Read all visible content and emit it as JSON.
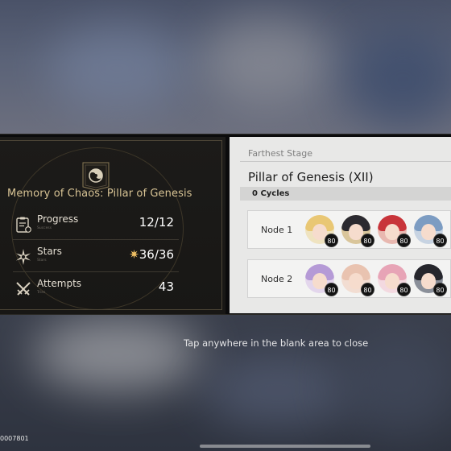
{
  "summary": {
    "title": "Memory of Chaos: Pillar of Genesis",
    "rows": [
      {
        "label": "Progress",
        "sub": "Success",
        "value": "12/12",
        "icon": "clipboard-icon"
      },
      {
        "label": "Stars",
        "sub": "Stars",
        "value": "36/36",
        "star_glyph": "✷",
        "icon": "star-burst-icon"
      },
      {
        "label": "Attempts",
        "sub": "Tries",
        "value": "43",
        "icon": "crossed-swords-icon"
      }
    ]
  },
  "stage": {
    "label": "Farthest Stage",
    "name": "Pillar of Genesis (XII)",
    "cycles": "0 Cycles",
    "nodes": [
      {
        "label": "Node 1",
        "levels": [
          "80",
          "80",
          "80",
          "80"
        ]
      },
      {
        "label": "Node 2",
        "levels": [
          "80",
          "80",
          "80",
          "80"
        ]
      }
    ]
  },
  "hint": "Tap anywhere in the blank area to close",
  "uid": "0007801",
  "colors": {
    "accent_gold": "#d7c394",
    "star": "#f0c064",
    "panel_light": "#e8e8e7",
    "panel_dark": "#181715"
  }
}
